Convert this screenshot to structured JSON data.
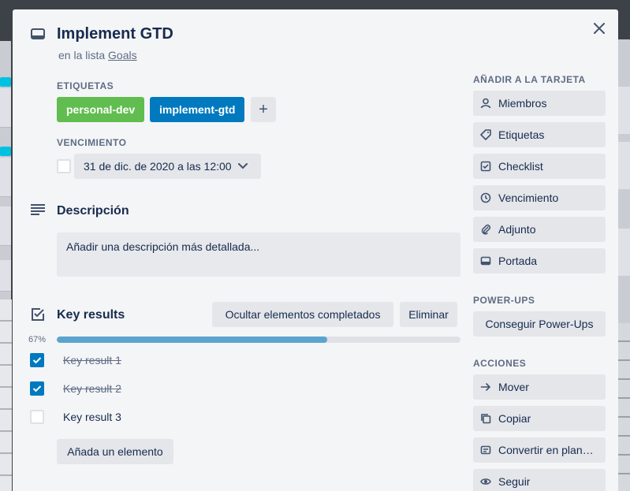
{
  "card": {
    "title": "Implement GTD",
    "in_list_prefix": "en la lista",
    "list_name": "Goals"
  },
  "labels": {
    "heading": "ETIQUETAS",
    "items": [
      {
        "name": "personal-dev",
        "color": "#61bd4f"
      },
      {
        "name": "implement-gtd",
        "color": "#0079bf"
      }
    ],
    "add_symbol": "+"
  },
  "due": {
    "heading": "VENCIMIENTO",
    "value": "31 de dic. de 2020 a las 12:00",
    "checked": false
  },
  "description": {
    "title": "Descripción",
    "placeholder": "Añadir una descripción más detallada..."
  },
  "checklist": {
    "title": "Key results",
    "hide_completed_label": "Ocultar elementos completados",
    "delete_label": "Eliminar",
    "progress_text": "67%",
    "progress_value": 67,
    "items": [
      {
        "text": "Key result 1",
        "done": true
      },
      {
        "text": "Key result 2",
        "done": true
      },
      {
        "text": "Key result 3",
        "done": false
      }
    ],
    "add_item_label": "Añada un elemento"
  },
  "sidebar": {
    "add_heading": "AÑADIR A LA TARJETA",
    "add_items": [
      {
        "label": "Miembros",
        "icon": "person-icon"
      },
      {
        "label": "Etiquetas",
        "icon": "tag-icon"
      },
      {
        "label": "Checklist",
        "icon": "checkbox-icon"
      },
      {
        "label": "Vencimiento",
        "icon": "clock-icon"
      },
      {
        "label": "Adjunto",
        "icon": "paperclip-icon"
      },
      {
        "label": "Portada",
        "icon": "cover-icon"
      }
    ],
    "powerups_heading": "POWER-UPS",
    "powerups_button": "Conseguir Power-Ups",
    "actions_heading": "ACCIONES",
    "actions": [
      {
        "label": "Mover",
        "icon": "arrow-right-icon"
      },
      {
        "label": "Copiar",
        "icon": "copy-icon"
      },
      {
        "label": "Convertir en plan…",
        "icon": "template-icon"
      },
      {
        "label": "Seguir",
        "icon": "eye-icon"
      }
    ]
  },
  "colors": {
    "modal_bg": "#f4f5f7",
    "button_bg": "#e4e6ea",
    "checked_blue": "#0079bf",
    "progress_fill": "#5ba4cf"
  }
}
